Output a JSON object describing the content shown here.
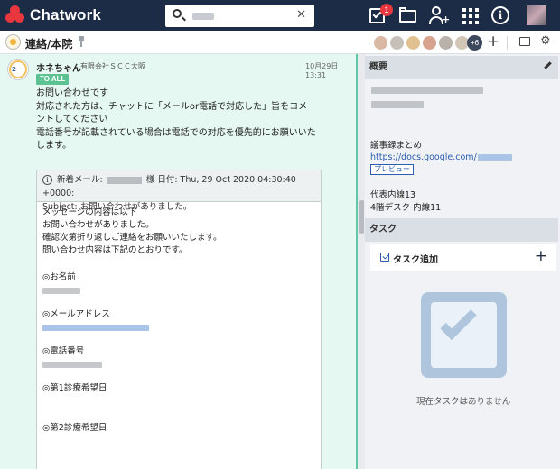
{
  "app": {
    "name": "Chatwork"
  },
  "search": {
    "placeholder": ""
  },
  "topbar": {
    "task_badge": "1",
    "info_glyph": "i",
    "contact_plus": "+"
  },
  "room": {
    "title": "連絡/本院",
    "member_more": "+6",
    "add_glyph": "+",
    "gear_glyph": "⚙"
  },
  "message": {
    "sender": "ホネちゃん",
    "org": "有限会社ＳＣＣ大阪",
    "time": "10月29日 13:31",
    "to_all": "TO ALL",
    "avatar_text": "2",
    "lines": [
      "お問い合わせです",
      "対応された方は、チャットに「メールor電話で対応した」旨をコメ",
      "ントしてください",
      "電話番号が記載されている場合は電話での対応を優先的にお願いいた",
      "します。"
    ],
    "mail": {
      "header_prefix": "新着メール:",
      "header_suffix": "様 日付: Thu, 29 Oct 2020 04:30:40 +0000:",
      "subject": "Subject: お問い合わせがありました。",
      "info_glyph": "i",
      "intro": [
        "メッセージの内容は以下",
        "お問い合わせがありました。",
        "確認次第折り返しご連絡をお願いいたします。",
        "問い合わせ内容は下記のとおりです。"
      ],
      "fields": [
        {
          "label": "◎お名前"
        },
        {
          "label": "◎メールアドレス"
        },
        {
          "label": "◎電話番号"
        },
        {
          "label": "◎第1診療希望日"
        },
        {
          "label": "◎第2診療希望日"
        }
      ]
    }
  },
  "panel": {
    "overview_title": "概要",
    "minutes_label": "議事録まとめ",
    "minutes_link": "https://docs.google.com/",
    "preview_label": "プレビュー",
    "ext_line1": "代表内線13",
    "ext_line2": "4階デスク 内線11",
    "task_title": "タスク",
    "task_add_label": "タスク追加",
    "task_add_glyph": "+",
    "empty_text": "現在タスクはありません"
  }
}
